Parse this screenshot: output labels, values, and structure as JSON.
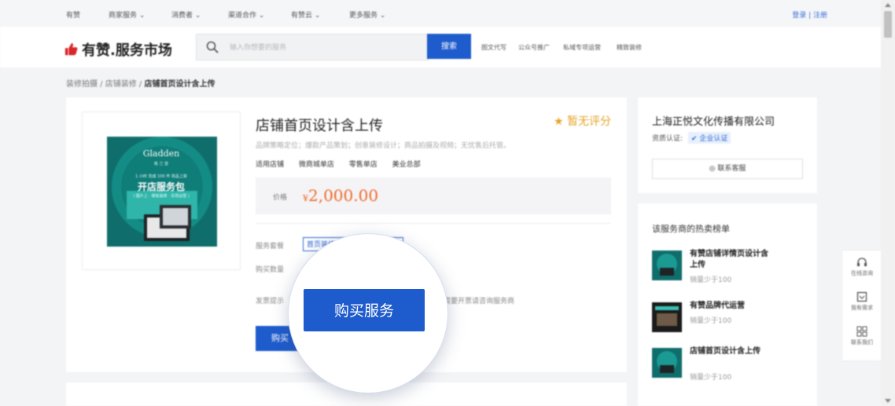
{
  "colors": {
    "accent_blue": "#1e5bcc",
    "price_orange": "#ef6a2c",
    "star_gold": "#e4a327"
  },
  "topnav": {
    "items": [
      "有赞",
      "商家服务",
      "消费者",
      "渠道合作",
      "有赞云",
      "更多服务"
    ],
    "login": "登录",
    "register": "注册"
  },
  "header": {
    "logo_text": "有赞.服务市场",
    "search_placeholder": "输入你想要的服务",
    "search_button": "搜索",
    "hot_links": [
      "图文代写",
      "公众号推广",
      "私域专项运营",
      "精致装修"
    ]
  },
  "breadcrumb": {
    "items": [
      "装修拍摄",
      "店铺装修"
    ],
    "current": "店铺首页设计含上传"
  },
  "product": {
    "image_text": {
      "brand": "Gladden",
      "brand_sub": "格 兰 登",
      "promo_small": "1 小时 完成 100 件 商品上架",
      "promo_big": "开店服务包",
      "promo_sub": "( 图片上 · 模板装修 · 实现运营 )"
    },
    "title": "店铺首页设计含上传",
    "rating": "暂无评分",
    "description": "品牌策略定位；爆款产品策划；创意装修设计；商品拍摄及视频；无忧售后托管。",
    "tags": [
      "适用店铺",
      "微商城单店",
      "零售单店",
      "美业总部"
    ],
    "price_label": "价格",
    "price_symbol": "¥",
    "price_value": "2,000.00",
    "service_label": "服务套餐",
    "service_option": "首页装修",
    "quantity_label": "购买数量",
    "note_prefix": "发票提示",
    "note_suffix": "需要开票请咨询服务商",
    "buy_small": "购买",
    "buy_big": "购买服务"
  },
  "company": {
    "name": "上海正悦文化传播有限公司",
    "cert_label": "资质认证:",
    "cert_badge": "企业认证",
    "contact": "联系客服"
  },
  "hot_list": {
    "heading": "该服务商的热卖榜单",
    "items": [
      {
        "title": "有赞店铺详情页设计含上传",
        "sales": "销量少于100"
      },
      {
        "title": "有赞品牌代运营",
        "sales": "销量少于100"
      },
      {
        "title": "店铺首页设计含上传",
        "sales": "销量少于100"
      }
    ]
  },
  "side_tools": [
    "在线咨询",
    "我有需求",
    "联系我们"
  ]
}
